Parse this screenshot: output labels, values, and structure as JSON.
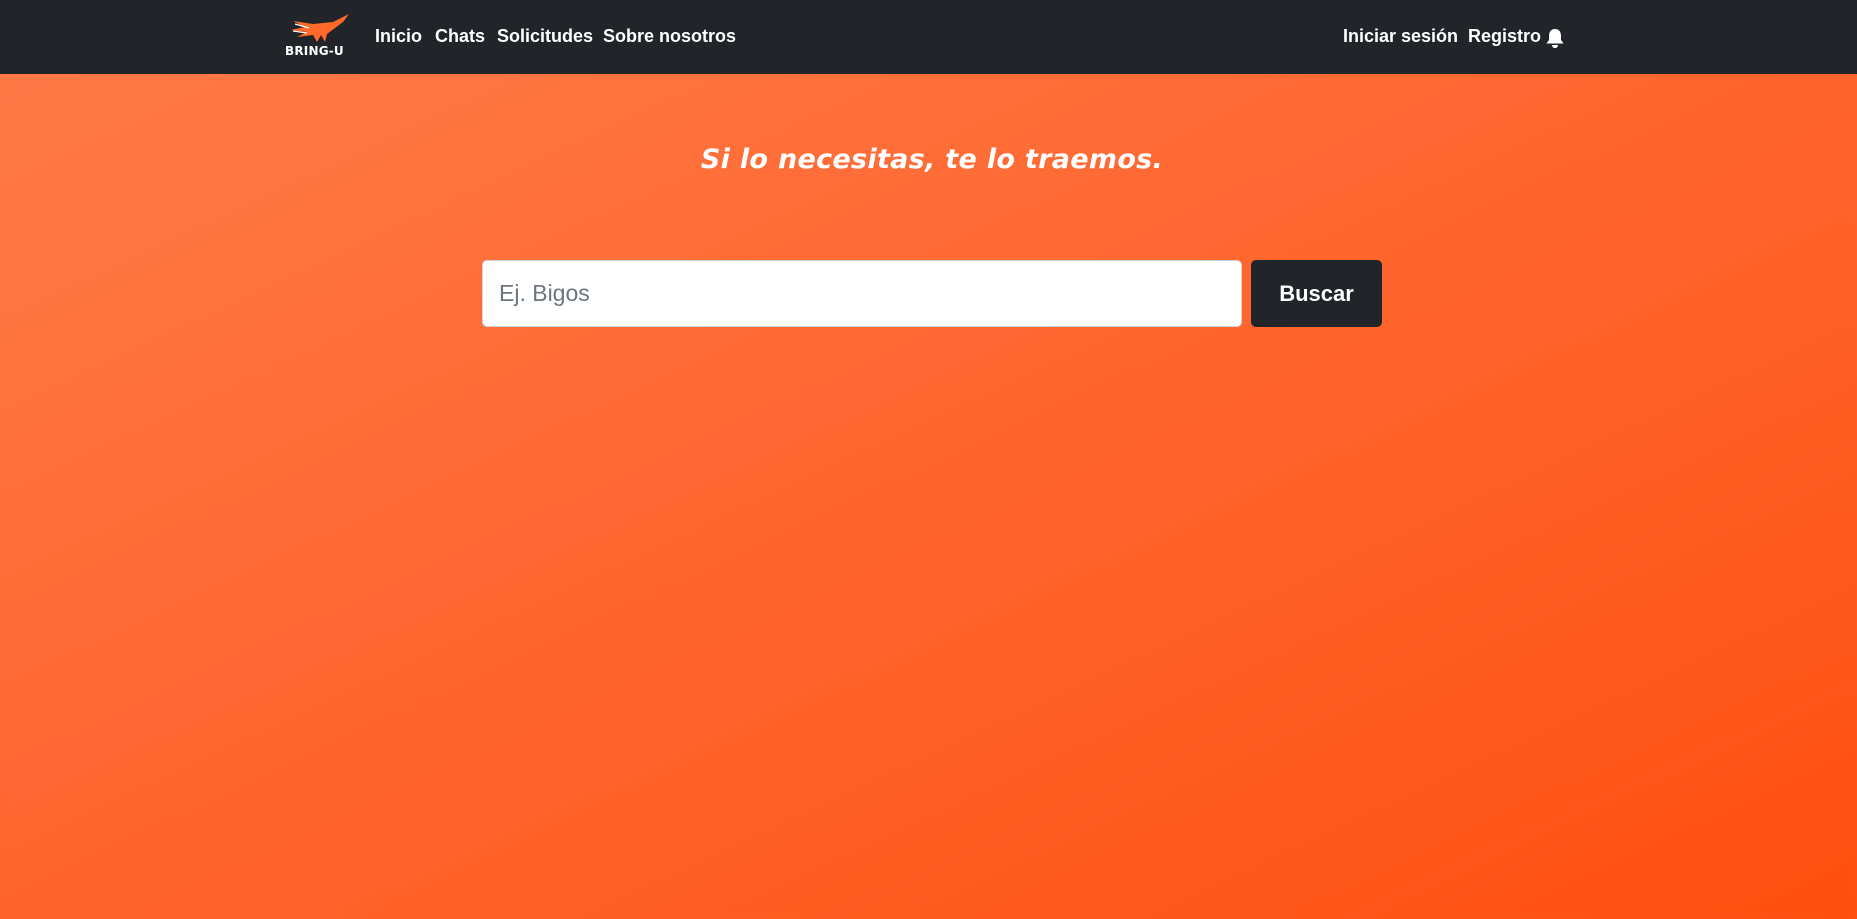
{
  "brand": {
    "logo_icon": "bird-icon",
    "name": "BRING-U"
  },
  "nav": {
    "left_links": [
      "Inicio",
      "Chats",
      "Solicitudes",
      "Sobre nosotros"
    ],
    "login": "Iniciar sesión",
    "register": "Registro",
    "notification_icon": "bell-icon"
  },
  "hero": {
    "tagline": "Si lo necesitas, te lo traemos."
  },
  "search": {
    "placeholder": "Ej. Bigos",
    "value": "",
    "button_label": "Buscar"
  },
  "colors": {
    "navbar": "#212529",
    "background_start": "#ff7b4a",
    "background_end": "#ff4f10",
    "button": "#212529",
    "logo_accent": "#ff6a2b"
  }
}
